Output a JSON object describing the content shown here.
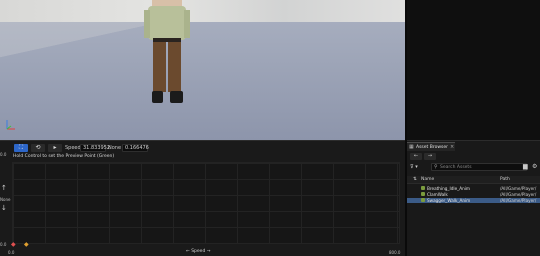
{
  "timeline": {
    "play_label": "▸",
    "speed_label": "Speed",
    "speed_value": "31.833952",
    "none_label": "None",
    "none_value": "0.166476",
    "hint": "Hold Control to set the Preview Point (Green)",
    "y_top": "0.0",
    "y_mid": "None",
    "y_bottom": "0.0",
    "x_left": "0.0",
    "x_right": "800.0",
    "x_axis_label": "Speed"
  },
  "asset_browser": {
    "tab_label": "Asset Browser",
    "search_placeholder": "Search Assets",
    "col_name": "Name",
    "col_path": "Path",
    "items": [
      {
        "name": "Breathing_Idle_Anim",
        "path": "/All/Game/Player/"
      },
      {
        "name": "ClamWalk",
        "path": "/All/Game/Player/"
      },
      {
        "name": "Swagger_Walk_Anim",
        "path": "/All/Game/Player/"
      }
    ]
  },
  "colors": {
    "accent": "#2d66c8",
    "selection": "#3b5b87",
    "anim_icon": "#7a9b3e"
  }
}
